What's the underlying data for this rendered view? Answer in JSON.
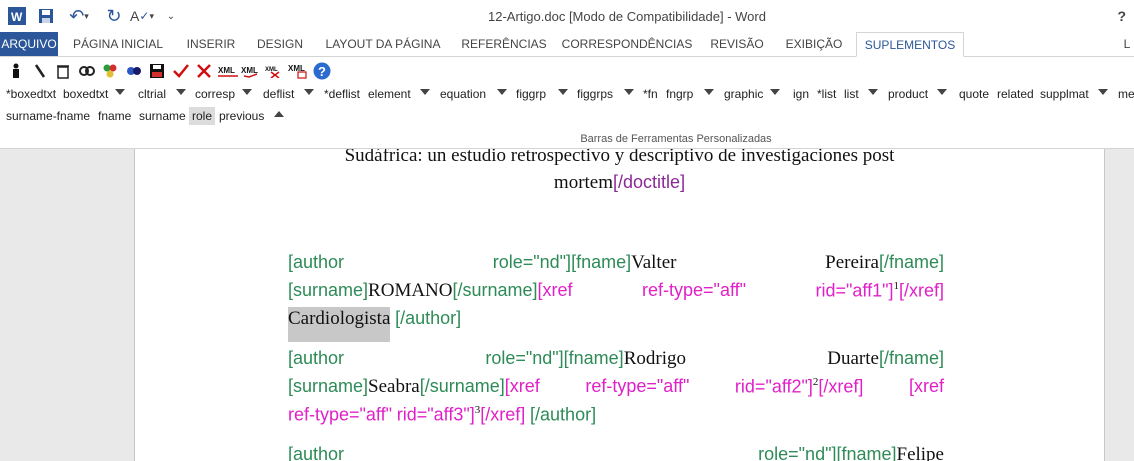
{
  "window": {
    "title": "12-Artigo.doc [Modo de Compatibilidade] - Word",
    "help": "?"
  },
  "quick_access": [
    {
      "name": "word-logo-icon",
      "glyph": "W"
    },
    {
      "name": "save-icon",
      "glyph": "💾"
    },
    {
      "name": "undo-icon",
      "glyph": "↶"
    },
    {
      "name": "redo-icon",
      "glyph": "↻"
    },
    {
      "name": "spelling-icon",
      "glyph": "A✓"
    },
    {
      "name": "customize-icon",
      "glyph": "⌄"
    }
  ],
  "tabs": [
    "ARQUIVO",
    "PÁGINA INICIAL",
    "INSERIR",
    "DESIGN",
    "LAYOUT DA PÁGINA",
    "REFERÊNCIAS",
    "CORRESPONDÊNCIAS",
    "REVISÃO",
    "EXIBIÇÃO",
    "SUPLEMENTOS",
    "L"
  ],
  "active_tab": "SUPLEMENTOS",
  "toolbar_icons": [
    "person-icon",
    "pen-icon",
    "trash-icon",
    "chain-icon",
    "flower-icon",
    "gears-icon",
    "disk-icon",
    "check-icon",
    "cross-icon",
    "xml-icon",
    "xml-check-icon",
    "xml-cross-icon",
    "xml-doc-icon",
    "help-icon"
  ],
  "tag_row_1": [
    "*boxedtxt",
    "boxedtxt",
    "cltrial",
    "corresp",
    "deflist",
    "*deflist",
    "element",
    "equation",
    "figgrp",
    "figgrps",
    "*fn",
    "fngrp",
    "graphic",
    "ign",
    "*list",
    "list",
    "product",
    "quote",
    "related",
    "supplmat",
    "me"
  ],
  "tag_row_2": [
    "surname-fname",
    "fname",
    "surname",
    "role",
    "previous"
  ],
  "selected_tag": "role",
  "group_label": "Barras de Ferramentas Personalizadas",
  "document": {
    "title_line1": "Sudáfrica: un estudio retrospectivo y descriptivo de investigaciones post",
    "title_line2_text": "mortem",
    "doctitle_close": "[/doctitle]",
    "author1": {
      "open": "[author",
      "role": "role=\"nd\"][fname]",
      "fname": "Valter",
      "lname": "Pereira",
      "fname_close": "[/fname]",
      "surname_open": "[surname]",
      "surname": "ROMANO",
      "surname_close": "[/surname]",
      "xref1": "[xref",
      "xref2": "ref-type=\"aff\"",
      "xref3": "rid=\"aff1\"]",
      "sup": "1",
      "xref_close": "[/xref]",
      "role_text": "Cardiologista",
      "author_close": "[/author]"
    },
    "author2": {
      "open": "[author",
      "role": "role=\"nd\"][fname]",
      "fname": "Rodrigo",
      "lname": "Duarte",
      "fname_close": "[/fname]",
      "surname_open": "[surname]",
      "surname": "Seabra",
      "surname_close": "[/surname]",
      "xref_a1": "[xref",
      "xref_a2": "ref-type=\"aff\"",
      "xref_a3": "rid=\"aff2\"]",
      "sup_a": "2",
      "xref_a_close": "[/xref]",
      "xref_b1": "[xref",
      "xref_b2": "ref-type=\"aff\"",
      "xref_b3": "rid=\"aff3\"]",
      "sup_b": "3",
      "xref_b_close": "[/xref]",
      "author_close": "[/author]"
    },
    "author3": {
      "open": "[author",
      "role": "role=\"nd\"][fname]",
      "fname": "Felipe"
    }
  }
}
